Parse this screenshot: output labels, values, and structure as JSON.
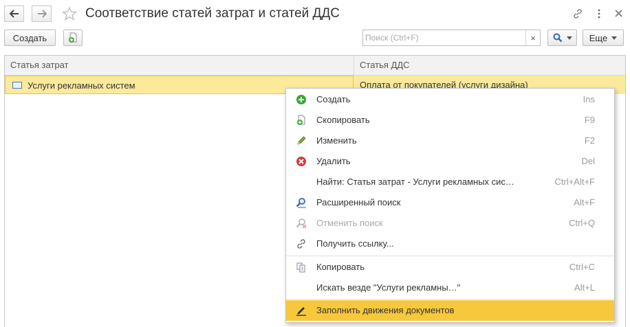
{
  "window": {
    "title": "Соответствие статей затрат и статей ДДС",
    "back_icon": "arrow-left-icon",
    "forward_icon": "arrow-right-icon",
    "favorite_icon": "star-outline-icon",
    "link_icon": "link-icon",
    "more_icon": "vertical-dots-icon",
    "close_icon": "close-icon"
  },
  "toolbar": {
    "create_label": "Создать",
    "copy_icon": "add-copy-icon",
    "search_placeholder": "Поиск (Ctrl+F)",
    "search_clear": "×",
    "search_icon": "magnifier-icon",
    "more_label": "Еще"
  },
  "table": {
    "columns": [
      "Статья затрат",
      "Статья ДДС"
    ],
    "rows": [
      {
        "cost_item": "Услуги рекламных систем",
        "cash_flow_item": "Оплата от покупателей (услуги дизайна)"
      }
    ]
  },
  "context_menu": {
    "items": [
      {
        "label": "Создать",
        "shortcut": "Ins",
        "icon": "plus-circle-icon"
      },
      {
        "label": "Скопировать",
        "shortcut": "F9",
        "icon": "copy-doc-icon"
      },
      {
        "label": "Изменить",
        "shortcut": "F2",
        "icon": "pencil-icon"
      },
      {
        "label": "Удалить",
        "shortcut": "Del",
        "icon": "delete-circle-icon"
      },
      {
        "label": "Найти: Статья затрат - Услуги рекламных сис…",
        "shortcut": "Ctrl+Alt+F",
        "icon": ""
      },
      {
        "label": "Расширенный поиск",
        "shortcut": "Alt+F",
        "icon": "advanced-search-icon"
      },
      {
        "label": "Отменить поиск",
        "shortcut": "Ctrl+Q",
        "icon": "cancel-search-icon"
      },
      {
        "label": "Получить ссылку...",
        "shortcut": "",
        "icon": "link-icon"
      },
      {
        "label": "Копировать",
        "shortcut": "Ctrl+C",
        "icon": "clipboard-copy-icon"
      },
      {
        "label": "Искать везде \"Услуги рекламны…\"",
        "shortcut": "Alt+L",
        "icon": ""
      },
      {
        "label": "Заполнить движения документов",
        "shortcut": "",
        "icon": "pen-icon"
      }
    ]
  },
  "colors": {
    "selected_row": "#fbe99c",
    "menu_highlight": "#f7c83b",
    "create_icon": "#3aa63a",
    "delete_icon": "#d93a3a"
  }
}
